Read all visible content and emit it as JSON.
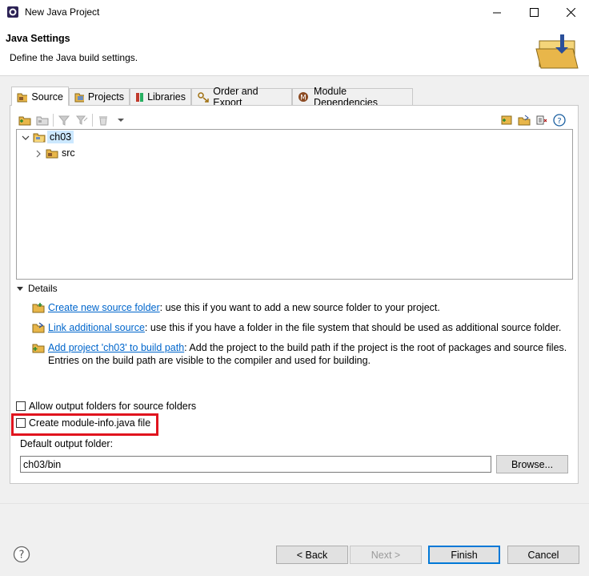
{
  "window": {
    "title": "New Java Project",
    "min_icon": "minimize-icon",
    "max_icon": "maximize-icon",
    "close_icon": "close-icon"
  },
  "banner": {
    "title": "Java Settings",
    "description": "Define the Java build settings."
  },
  "tabs": [
    {
      "label": "Source",
      "icon": "source-folder-icon",
      "active": true
    },
    {
      "label": "Projects",
      "icon": "projects-icon",
      "active": false
    },
    {
      "label": "Libraries",
      "icon": "libraries-icon",
      "active": false
    },
    {
      "label": "Order and Export",
      "icon": "order-export-icon",
      "active": false
    },
    {
      "label": "Module Dependencies",
      "icon": "module-icon",
      "active": false
    }
  ],
  "tree": {
    "root": {
      "label": "ch03",
      "expanded": true
    },
    "child": {
      "label": "src",
      "expanded": false
    }
  },
  "details": {
    "heading": "Details",
    "items": [
      {
        "link": "Create new source folder",
        "text": ": use this if you want to add a new source folder to your project."
      },
      {
        "link": "Link additional source",
        "text": ": use this if you have a folder in the file system that should be used as additional source folder."
      },
      {
        "link": "Add project 'ch03' to build path",
        "text": ": Add the project to the build path if the project is the root of packages and source files.",
        "text2": "Entries on the build path are visible to the compiler and used for building."
      }
    ]
  },
  "options": {
    "allow_output": {
      "label": "Allow output folders for source folders",
      "checked": false
    },
    "module_info": {
      "label": "Create module-info.java file",
      "checked": false,
      "highlight_color": "#e0141e"
    }
  },
  "output": {
    "label": "Default output folder:",
    "value": "ch03/bin",
    "browse": "Browse..."
  },
  "footer": {
    "back": "< Back",
    "next": "Next >",
    "finish": "Finish",
    "cancel": "Cancel"
  },
  "colors": {
    "accent": "#0078d7",
    "link": "#0066cc",
    "folder": "#e8b64a"
  }
}
